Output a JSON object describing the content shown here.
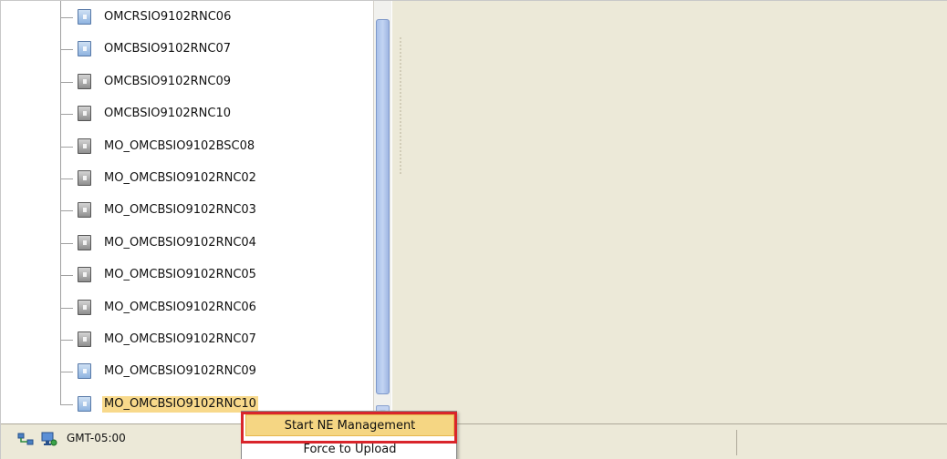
{
  "tree": {
    "items": [
      {
        "label": "OMCRSIO9102RNC06",
        "icon": "ne-node-icon",
        "color": "blue",
        "selected": false
      },
      {
        "label": "OMCBSIO9102RNC07",
        "icon": "ne-node-icon",
        "color": "blue",
        "selected": false
      },
      {
        "label": "OMCBSIO9102RNC09",
        "icon": "ne-node-icon",
        "color": "gray",
        "selected": false
      },
      {
        "label": "OMCBSIO9102RNC10",
        "icon": "ne-node-icon",
        "color": "gray",
        "selected": false
      },
      {
        "label": "MO_OMCBSIO9102BSC08",
        "icon": "ne-node-icon",
        "color": "gray",
        "selected": false
      },
      {
        "label": "MO_OMCBSIO9102RNC02",
        "icon": "ne-node-icon",
        "color": "gray",
        "selected": false
      },
      {
        "label": "MO_OMCBSIO9102RNC03",
        "icon": "ne-node-icon",
        "color": "gray",
        "selected": false
      },
      {
        "label": "MO_OMCBSIO9102RNC04",
        "icon": "ne-node-icon",
        "color": "gray",
        "selected": false
      },
      {
        "label": "MO_OMCBSIO9102RNC05",
        "icon": "ne-node-icon",
        "color": "gray",
        "selected": false
      },
      {
        "label": "MO_OMCBSIO9102RNC06",
        "icon": "ne-node-icon",
        "color": "gray",
        "selected": false
      },
      {
        "label": "MO_OMCBSIO9102RNC07",
        "icon": "ne-node-icon",
        "color": "gray",
        "selected": false
      },
      {
        "label": "MO_OMCBSIO9102RNC09",
        "icon": "ne-node-icon",
        "color": "blue",
        "selected": false
      },
      {
        "label": "MO_OMCBSIO9102RNC10",
        "icon": "ne-node-icon",
        "color": "blue",
        "selected": true
      }
    ]
  },
  "context_menu": {
    "items": [
      {
        "label": "Start NE Management",
        "highlighted": true
      },
      {
        "label": "Force to Upload",
        "highlighted": false
      }
    ],
    "highlight_color": "#d9252b"
  },
  "status_bar": {
    "timezone": "GMT-05:00",
    "icons": [
      "network-topology-icon",
      "monitor-connection-icon"
    ]
  },
  "colors": {
    "selection": "#f8d98b",
    "menu_highlight": "#f5d683",
    "scroll_thumb": "#a9c0e9",
    "panel_background": "#ece9d8"
  }
}
